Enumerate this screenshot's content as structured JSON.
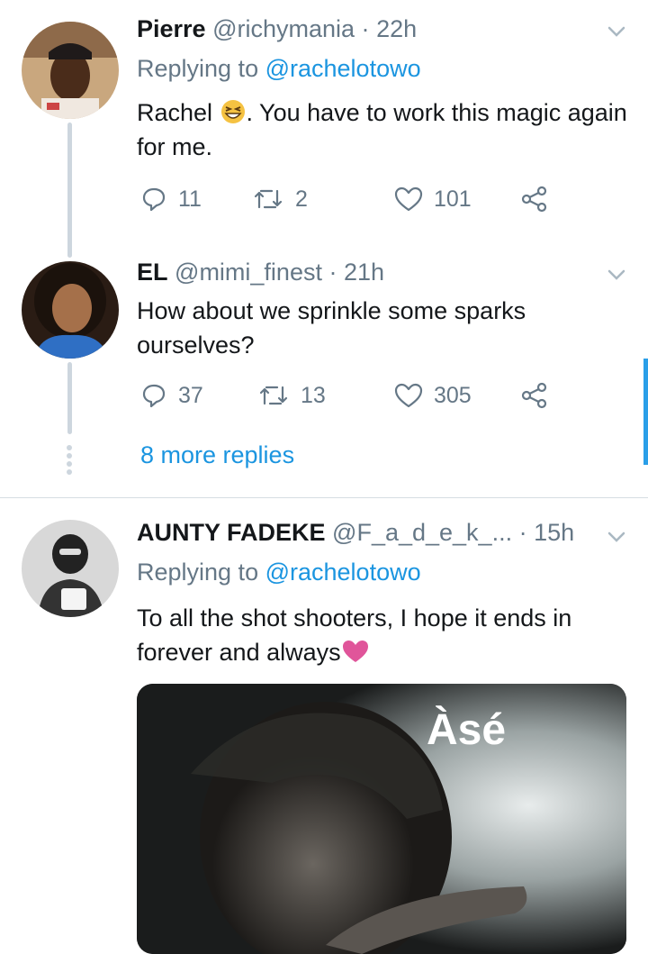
{
  "tweets": [
    {
      "name": "Pierre",
      "handle": "@richymania",
      "time": "22h",
      "replying_label": "Replying to",
      "replying_to": "@rachelotowo",
      "text_before_emoji": "Rachel ",
      "emoji_icon": "grinning-squinting-face-emoji",
      "text_after_emoji": ". You have to work this magic again for me.",
      "replies": "11",
      "retweets": "2",
      "likes": "101"
    },
    {
      "name": "EL",
      "handle": "@mimi_finest",
      "time": "21h",
      "text": "How about we sprinkle some sparks ourselves?",
      "replies": "37",
      "retweets": "13",
      "likes": "305",
      "more_replies": "8 more replies"
    },
    {
      "name": "AUNTY FADEKE",
      "handle": "@F_a_d_e_k_...",
      "time": "15h",
      "replying_label": "Replying to",
      "replying_to": "@rachelotowo",
      "text": "To all the shot shooters, I hope it ends in forever and always",
      "emoji_icon": "pink-heart-emoji",
      "image_caption": "Àsé"
    }
  ],
  "separator": "·",
  "colors": {
    "link": "#1b95e0",
    "muted": "#657786",
    "divider": "#d6dde3",
    "heart": "#e0559a"
  }
}
